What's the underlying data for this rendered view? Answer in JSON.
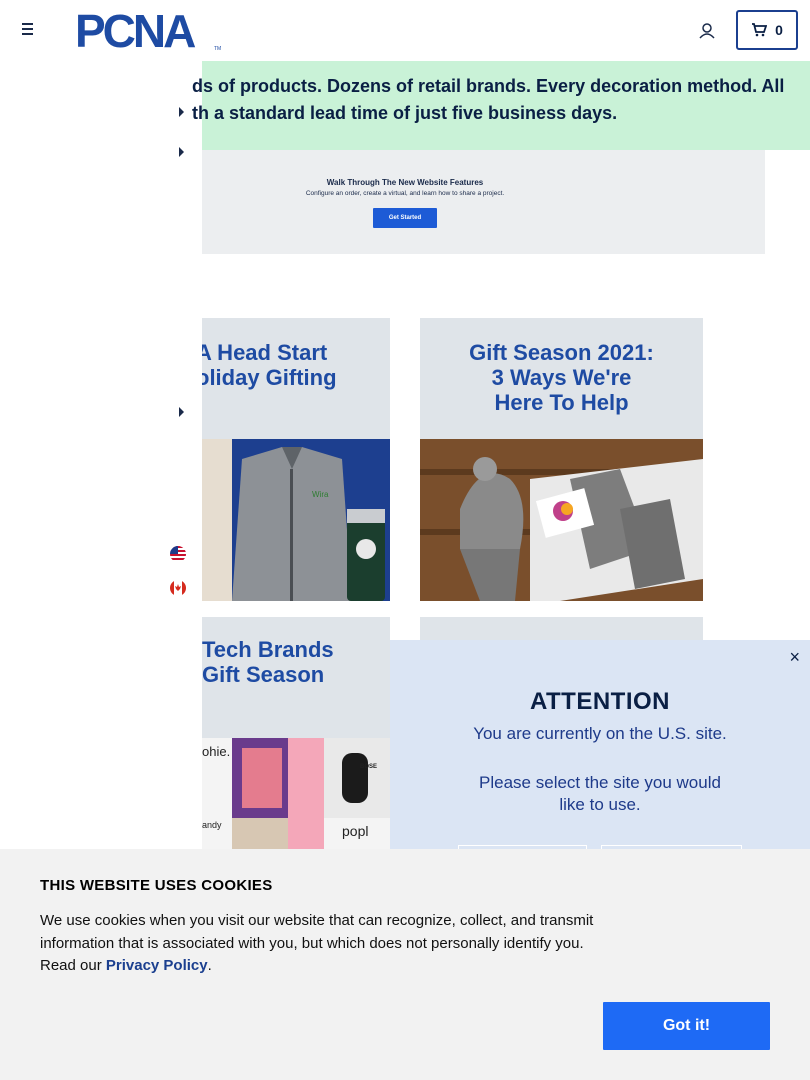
{
  "header": {
    "logo_text": "PCNA",
    "cart_count": "0"
  },
  "banner": {
    "line1": "ds of products. Dozens of retail brands. Every decoration method. All",
    "line2": "th a standard lead time of just five business days."
  },
  "walkthrough": {
    "title": "Walk Through The New Website Features",
    "subtitle": "Configure an order, create a virtual, and learn how to share a project.",
    "button": "Get Started"
  },
  "tiles": [
    {
      "title_line1": "A Head Start",
      "title_line2": "oliday Gifting"
    },
    {
      "title_line1": "Gift Season 2021:",
      "title_line2": "3 Ways We're",
      "title_line3": "Here To Help"
    },
    {
      "title_line1": "Tech Brands",
      "title_line2": "Gift Season",
      "brand_a": "ohie.",
      "brand_b": "BOSE",
      "brand_c": "andy",
      "brand_d": "popl",
      "wira": "Wira"
    }
  ],
  "modal": {
    "title": "ATTENTION",
    "line1": "You are currently on the U.S. site.",
    "line2": "Please select the site you would",
    "line3": "like to use.",
    "close": "×"
  },
  "cookie": {
    "title": "THIS WEBSITE USES COOKIES",
    "text": "We use cookies when you visit our website that can recognize, collect, and transmit information that is associated with you, but which does not personally identify you. Read our ",
    "link": "Privacy Policy",
    "after": ".",
    "button": "Got it!"
  },
  "colors": {
    "brand_blue": "#1e4ba3",
    "banner_green": "#c9f2d7",
    "modal_bg": "#dbe5f4",
    "cookie_button": "#1e6af5"
  }
}
